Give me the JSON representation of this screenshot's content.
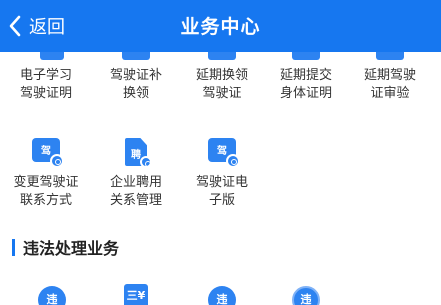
{
  "header": {
    "back_label": "返回",
    "title": "业务中心"
  },
  "grid_row1": [
    {
      "label": "电子学习\n驾驶证明"
    },
    {
      "label": "驾驶证补\n换领"
    },
    {
      "label": "延期换领\n驾驶证"
    },
    {
      "label": "延期提交\n身体证明"
    },
    {
      "label": "延期驾驶\n证审验"
    }
  ],
  "grid_row2": [
    {
      "label": "变更驾驶证\n联系方式",
      "icon_text": "驾"
    },
    {
      "label": "企业聘用\n关系管理",
      "icon_text": "聘"
    },
    {
      "label": "驾驶证电\n子版",
      "icon_text": "驾"
    }
  ],
  "section": {
    "title": "违法处理业务"
  },
  "bottom_icons": [
    {
      "icon_text": "违"
    },
    {
      "icon_text": "三¥"
    },
    {
      "icon_text": "违"
    },
    {
      "icon_text": "违"
    }
  ],
  "colors": {
    "primary": "#1677f0",
    "icon_blue": "#2d83f1",
    "text": "#333333"
  }
}
